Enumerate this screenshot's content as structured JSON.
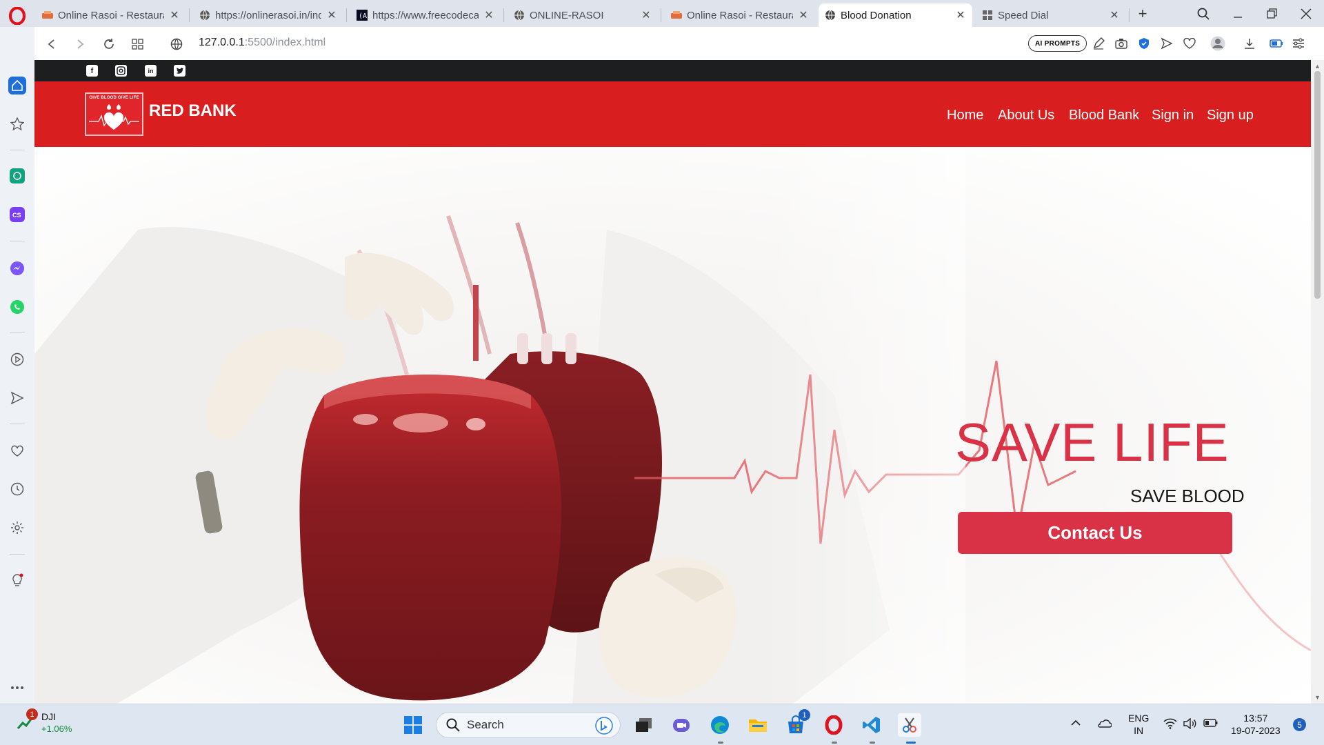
{
  "browser": {
    "tabs": [
      {
        "title": "Online Rasoi - Restaurant",
        "favicon": "rasoi-icon",
        "active": false
      },
      {
        "title": "https://onlinerasoi.in/index",
        "favicon": "globe-icon",
        "active": false
      },
      {
        "title": "https://www.freecodecamp",
        "favicon": "freecodecamp-icon",
        "active": false
      },
      {
        "title": "ONLINE-RASOI",
        "favicon": "globe-icon",
        "active": false
      },
      {
        "title": "Online Rasoi - Restaurant",
        "favicon": "rasoi-icon",
        "active": false
      },
      {
        "title": "Blood Donation",
        "favicon": "globe-icon",
        "active": true
      },
      {
        "title": "Speed Dial",
        "favicon": "speed-dial-icon",
        "active": false
      }
    ],
    "address": {
      "host": "127.0.0.1",
      "rest": ":5500/index.html"
    },
    "ai_prompts_label": "AI PROMPTS",
    "accent_color": "#1e6fd9"
  },
  "site": {
    "brand": "RED BANK",
    "logo_text": "GIVE BLOOD GIVE LIFE",
    "social": [
      "facebook",
      "instagram",
      "linkedin",
      "twitter"
    ],
    "nav": [
      "Home",
      "About Us",
      "Blood Bank",
      "Sign in",
      "Sign up"
    ],
    "nav_color": "#d81e1e",
    "hero": {
      "title": "SAVE LIFE",
      "subtitle": "SAVE BLOOD",
      "cta": "Contact Us",
      "accent_color": "#d93246"
    }
  },
  "taskbar": {
    "stock_name": "DJI",
    "stock_change": "+1.06%",
    "stock_badge": "1",
    "search_placeholder": "Search",
    "store_badge": "1",
    "lang": "ENG",
    "region": "IN",
    "time": "13:57",
    "date": "19-07-2023",
    "notification_count": "5"
  }
}
